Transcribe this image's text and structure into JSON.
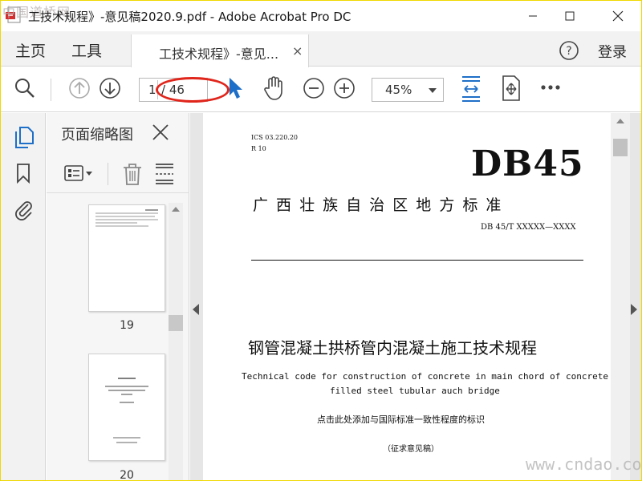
{
  "window": {
    "title": "工技术规程》-意见稿2020.9.pdf - Adobe Acrobat Pro DC",
    "watermark_top": "中国道桥网",
    "watermark_bottom": "www.cndao.com"
  },
  "nav": {
    "home": "主页",
    "tools": "工具"
  },
  "tab": {
    "label": "工技术规程》-意见...",
    "close": "×"
  },
  "header": {
    "login": "登录"
  },
  "toolbar": {
    "current_page": "1",
    "total_pages": "/ 46",
    "zoom": "45%"
  },
  "thumbnails_panel": {
    "title": "页面缩略图",
    "pages": [
      {
        "label": "19"
      },
      {
        "label": "20"
      }
    ]
  },
  "document": {
    "ics": "ICS 03.220.20",
    "class_code": "R 10",
    "standard_code": "DB45",
    "org": "广 西 壮 族 自 治 区 地 方 标 准",
    "doc_number": "DB 45/T XXXXX—XXXX",
    "title_cn": "钢管混凝土拱桥管内混凝土施工技术规程",
    "title_en_line1": "Technical code for construction of concrete in main chord of concrete",
    "title_en_line2": "filled steel tubular auch bridge",
    "note": "点击此处添加与国际标准一致性程度的标识",
    "stage": "（征求意见稿）"
  },
  "colors": {
    "accent_blue": "#1e6fc8",
    "annotation_red": "#e0251b",
    "chrome_bg": "#f2f2f2"
  }
}
